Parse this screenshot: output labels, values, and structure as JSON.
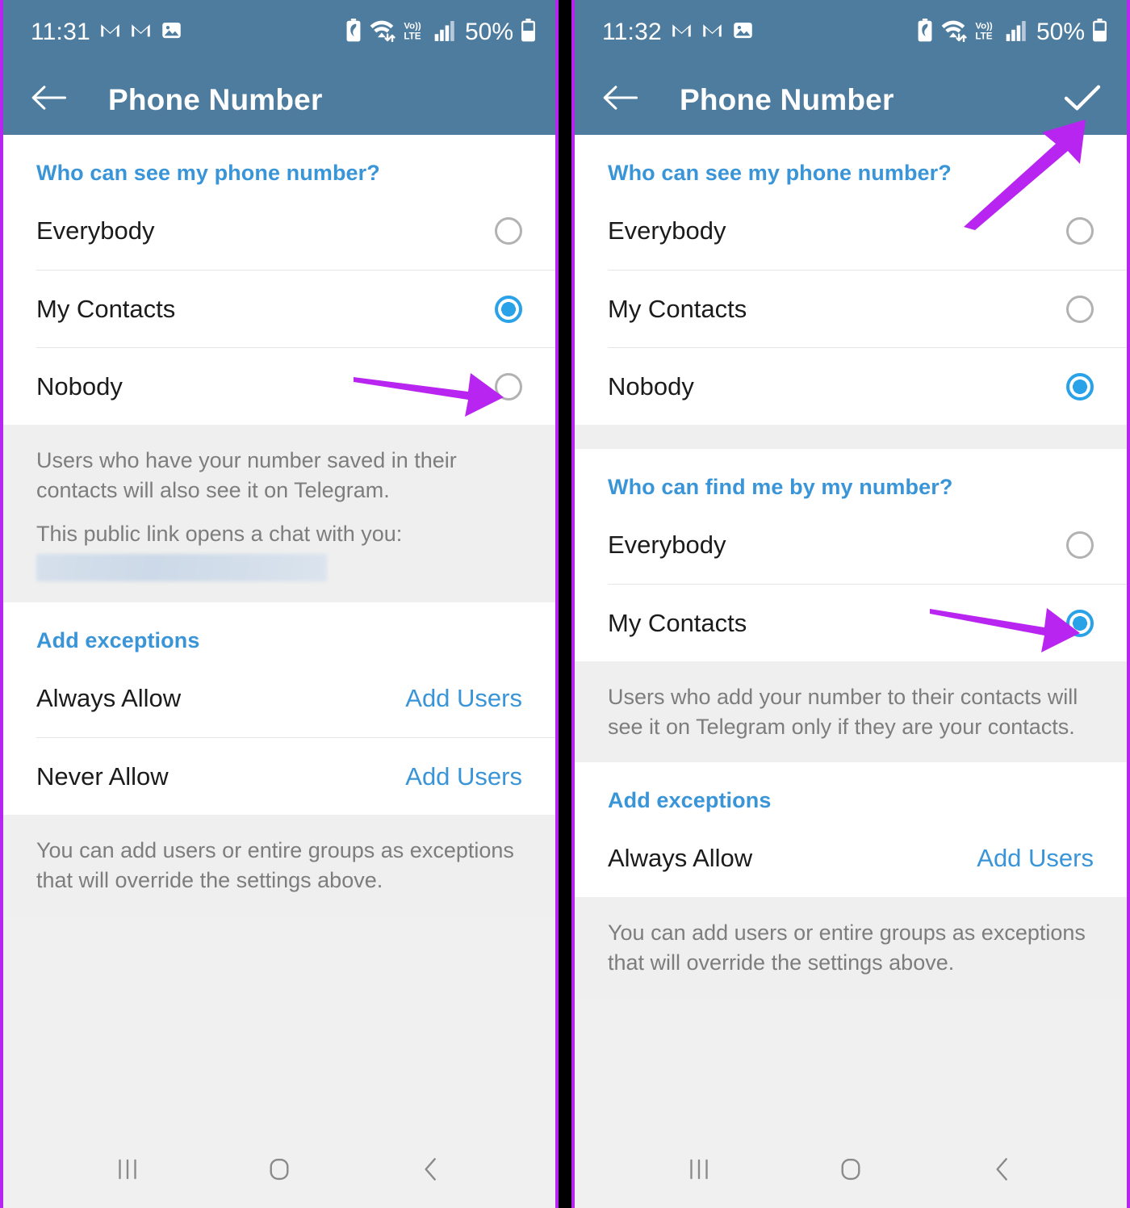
{
  "accent": {
    "header_bg": "#4e7c9e",
    "link_blue": "#3a95d8",
    "radio_on": "#2aa2e8",
    "annotation_purple": "#b925f0",
    "panel_border": "#b925f0",
    "note_text": "#7d7d7d"
  },
  "left": {
    "status": {
      "time": "11:31",
      "icons_left": [
        "gmail-icon",
        "gmail-icon",
        "photos-icon"
      ],
      "icons_right": [
        "battery-saver-icon",
        "wifi-icon",
        "volte-icon",
        "signal-icon"
      ],
      "volte_label_top": "Vo))",
      "volte_label_bottom": "LTE",
      "battery_percent": "50%"
    },
    "appbar": {
      "back_icon": "back-arrow-icon",
      "title": "Phone Number",
      "has_confirm": false
    },
    "sections": [
      {
        "header": "Who can see my phone number?",
        "options": [
          {
            "label": "Everybody",
            "selected": false
          },
          {
            "label": "My Contacts",
            "selected": true
          },
          {
            "label": "Nobody",
            "selected": false
          }
        ],
        "notes": [
          "Users who have your number saved in their contacts will also see it on Telegram.",
          "This public link opens a chat with you:"
        ],
        "has_blurred_link": true
      },
      {
        "header": "Add exceptions",
        "rows": [
          {
            "key": "Always Allow",
            "action": "Add Users"
          },
          {
            "key": "Never Allow",
            "action": "Add Users"
          }
        ],
        "notes": [
          "You can add users or entire groups as exceptions that will override the settings above."
        ]
      }
    ],
    "navbar": [
      "recents-icon",
      "home-icon",
      "back-icon"
    ]
  },
  "right": {
    "status": {
      "time": "11:32",
      "icons_left": [
        "gmail-icon",
        "gmail-icon",
        "photos-icon"
      ],
      "icons_right": [
        "battery-saver-icon",
        "wifi-icon",
        "volte-icon",
        "signal-icon"
      ],
      "volte_label_top": "Vo))",
      "volte_label_bottom": "LTE",
      "battery_percent": "50%"
    },
    "appbar": {
      "back_icon": "back-arrow-icon",
      "title": "Phone Number",
      "has_confirm": true,
      "confirm_icon": "checkmark-icon"
    },
    "sections": [
      {
        "header": "Who can see my phone number?",
        "options": [
          {
            "label": "Everybody",
            "selected": false
          },
          {
            "label": "My Contacts",
            "selected": false
          },
          {
            "label": "Nobody",
            "selected": true
          }
        ]
      },
      {
        "header": "Who can find me by my number?",
        "options": [
          {
            "label": "Everybody",
            "selected": false
          },
          {
            "label": "My Contacts",
            "selected": true
          }
        ],
        "notes": [
          "Users who add your number to their contacts will see it on Telegram only if they are your contacts."
        ]
      },
      {
        "header": "Add exceptions",
        "rows": [
          {
            "key": "Always Allow",
            "action": "Add Users"
          }
        ],
        "notes": [
          "You can add users or entire groups as exceptions that will override the settings above."
        ]
      }
    ],
    "navbar": [
      "recents-icon",
      "home-icon",
      "back-icon"
    ]
  },
  "annotations": [
    {
      "name": "arrow-to-nobody-radio",
      "panel": "left",
      "style": "horizontal-right"
    },
    {
      "name": "arrow-to-confirm-check",
      "panel": "right",
      "style": "diagonal-up-right"
    },
    {
      "name": "arrow-to-my-contacts-radio",
      "panel": "right",
      "style": "horizontal-right"
    }
  ]
}
